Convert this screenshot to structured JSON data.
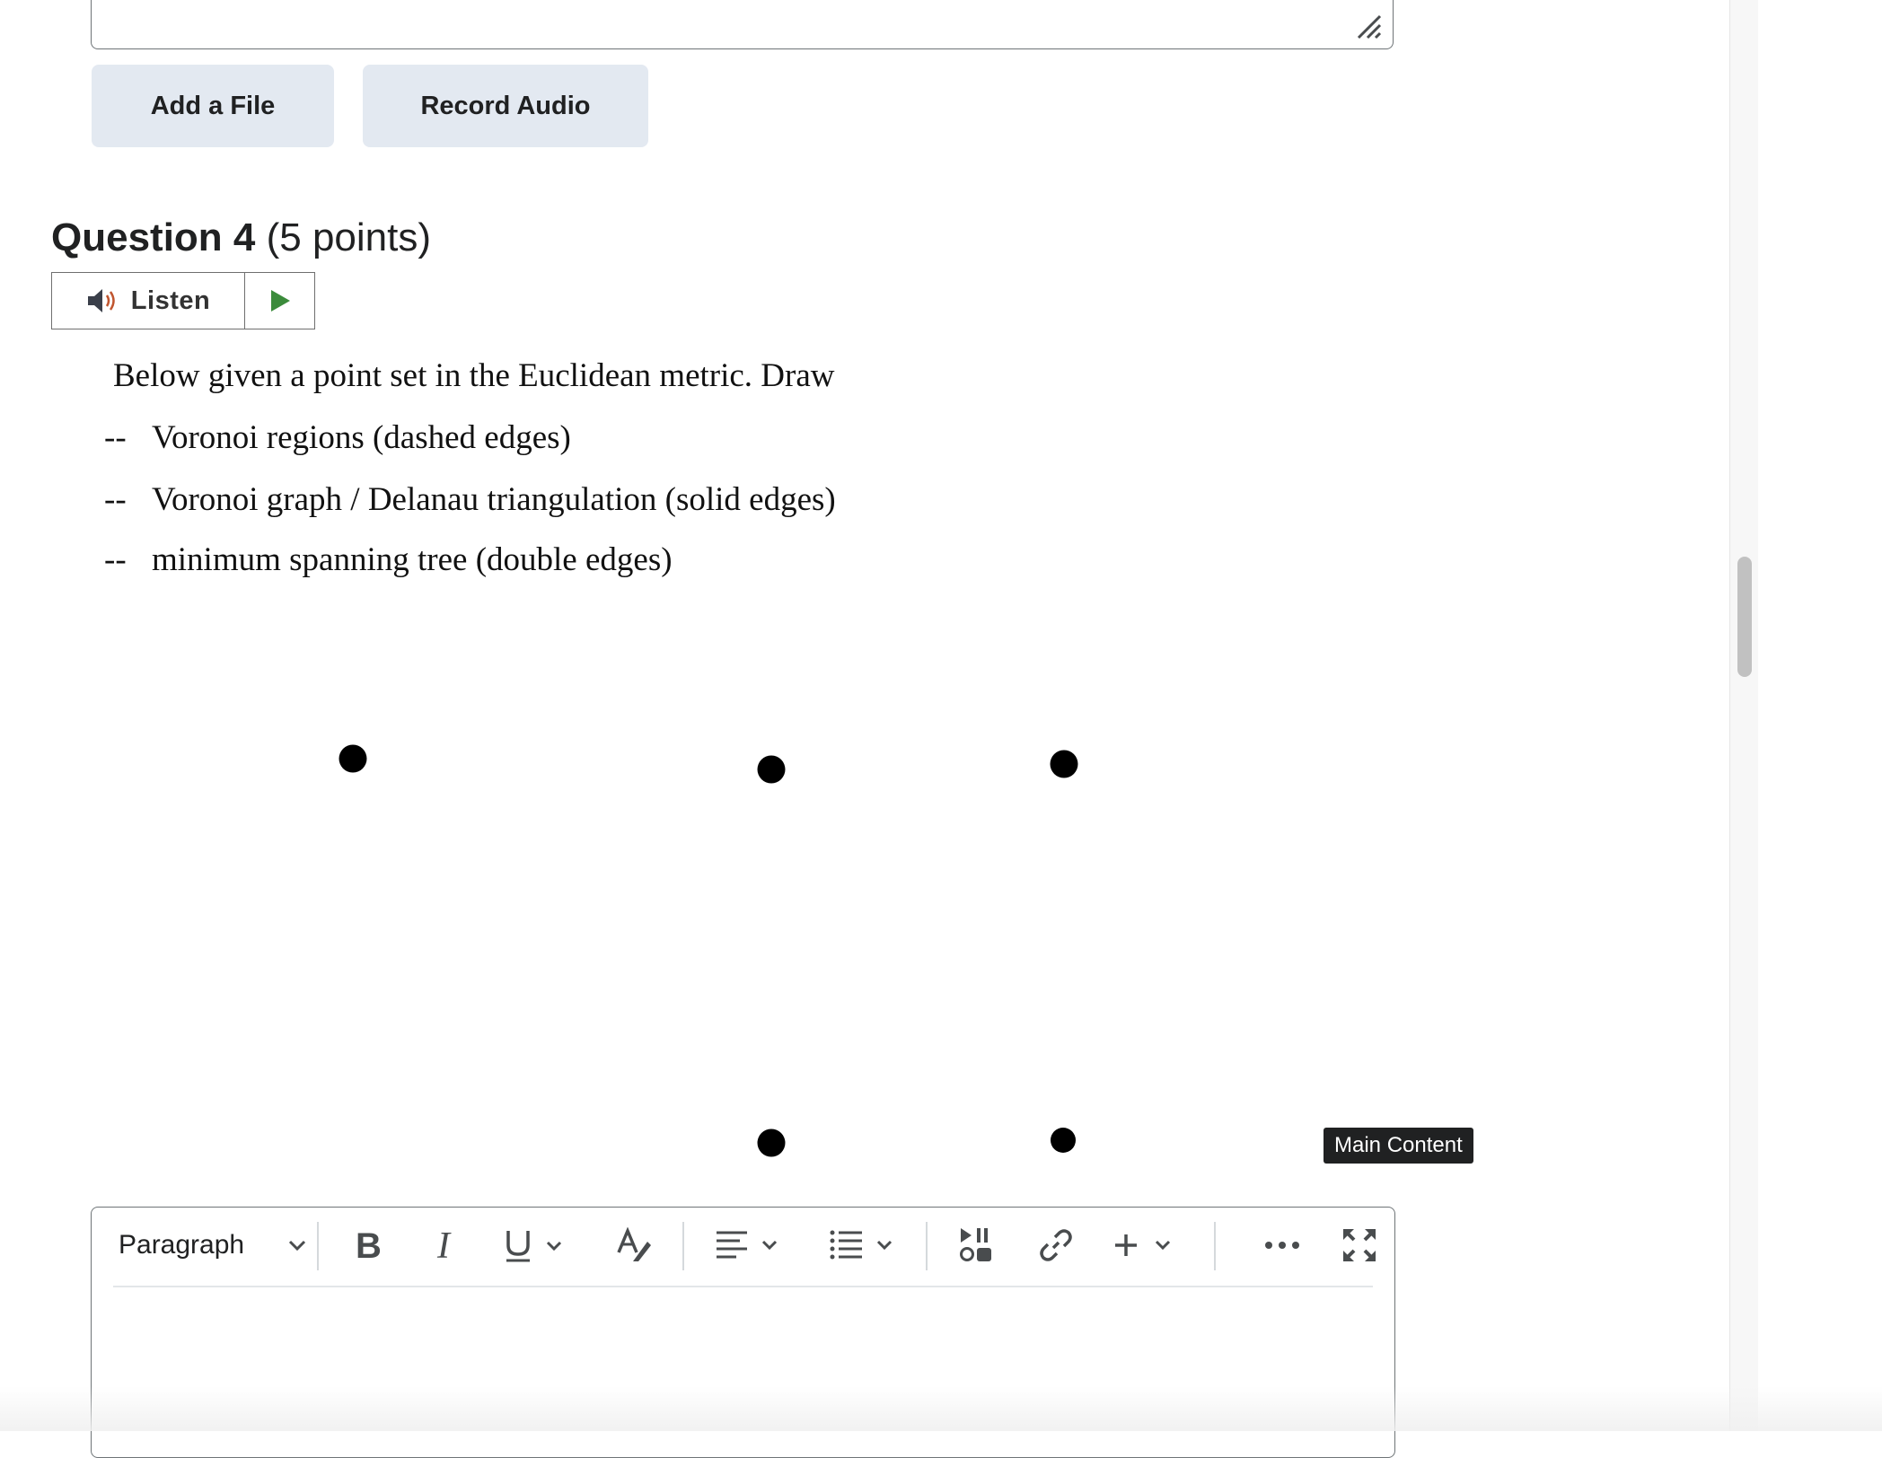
{
  "buttons": {
    "add_file": "Add a File",
    "record_audio": "Record Audio"
  },
  "question": {
    "title": "Question 4",
    "points": "(5 points)",
    "listen_label": "Listen",
    "intro": "Below given a point set in the Euclidean metric. Draw",
    "items": [
      {
        "dash": "--",
        "text": "Voronoi regions (dashed edges)"
      },
      {
        "dash": "--",
        "text": "Voronoi graph / Delanau triangulation (solid edges)"
      },
      {
        "dash": "--",
        "text": "minimum spanning tree (double edges)"
      }
    ],
    "point_count": 5
  },
  "tooltip": "Main Content",
  "editor": {
    "block_format": "Paragraph",
    "tools": [
      "bold-icon",
      "italic-icon",
      "underline-icon",
      "text-format-icon",
      "align-icon",
      "list-icon",
      "media-icon",
      "link-icon",
      "insert-icon",
      "more-icon",
      "fullscreen-icon"
    ]
  },
  "colors": {
    "button_bg": "#e3e9f1",
    "play_green": "#3b8b3b",
    "tooltip_bg": "#202122"
  }
}
